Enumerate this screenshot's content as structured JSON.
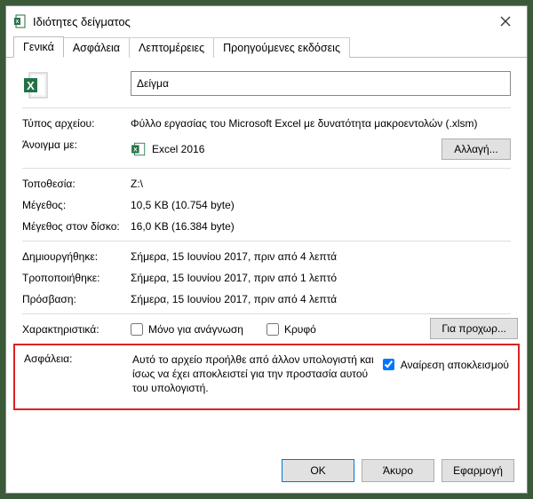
{
  "titlebar": {
    "title": "Ιδιότητες δείγματος"
  },
  "tabs": {
    "general": "Γενικά",
    "security": "Ασφάλεια",
    "details": "Λεπτομέρειες",
    "previous": "Προηγούμενες εκδόσεις"
  },
  "name_value": "Δείγμα",
  "labels": {
    "type": "Τύπος αρχείου:",
    "opens_with": "Άνοιγμα με:",
    "location": "Τοποθεσία:",
    "size": "Μέγεθος:",
    "size_on_disk": "Μέγεθος στον δίσκο:",
    "created": "Δημιουργήθηκε:",
    "modified": "Τροποποιήθηκε:",
    "accessed": "Πρόσβαση:",
    "attributes": "Χαρακτηριστικά:",
    "security_label": "Ασφάλεια:"
  },
  "values": {
    "type": "Φύλλο εργασίας του Microsoft Excel με δυνατότητα μακροεντολών (.xlsm)",
    "opens_with_app": "Excel 2016",
    "change_btn": "Αλλαγή...",
    "location": "Z:\\",
    "size": "10,5 KB (10.754 byte)",
    "size_on_disk": "16,0 KB (16.384 byte)",
    "created": "Σήμερα, 15 Ιουνίου 2017, πριν από 4 λεπτά",
    "modified": "Σήμερα, 15 Ιουνίου 2017, πριν από 1 λεπτό",
    "accessed": "Σήμερα, 15 Ιουνίου 2017, πριν από 4 λεπτά",
    "readonly": "Μόνο για ανάγνωση",
    "hidden": "Κρυφό",
    "advanced_btn": "Για προχωρ...",
    "security_text": "Αυτό το αρχείο προήλθε από άλλον υπολογιστή και ίσως να έχει αποκλειστεί για την προστασία αυτού του υπολογιστή.",
    "unblock": "Αναίρεση αποκλεισμού"
  },
  "footer": {
    "ok": "OK",
    "cancel": "Άκυρο",
    "apply": "Εφαρμογή"
  }
}
